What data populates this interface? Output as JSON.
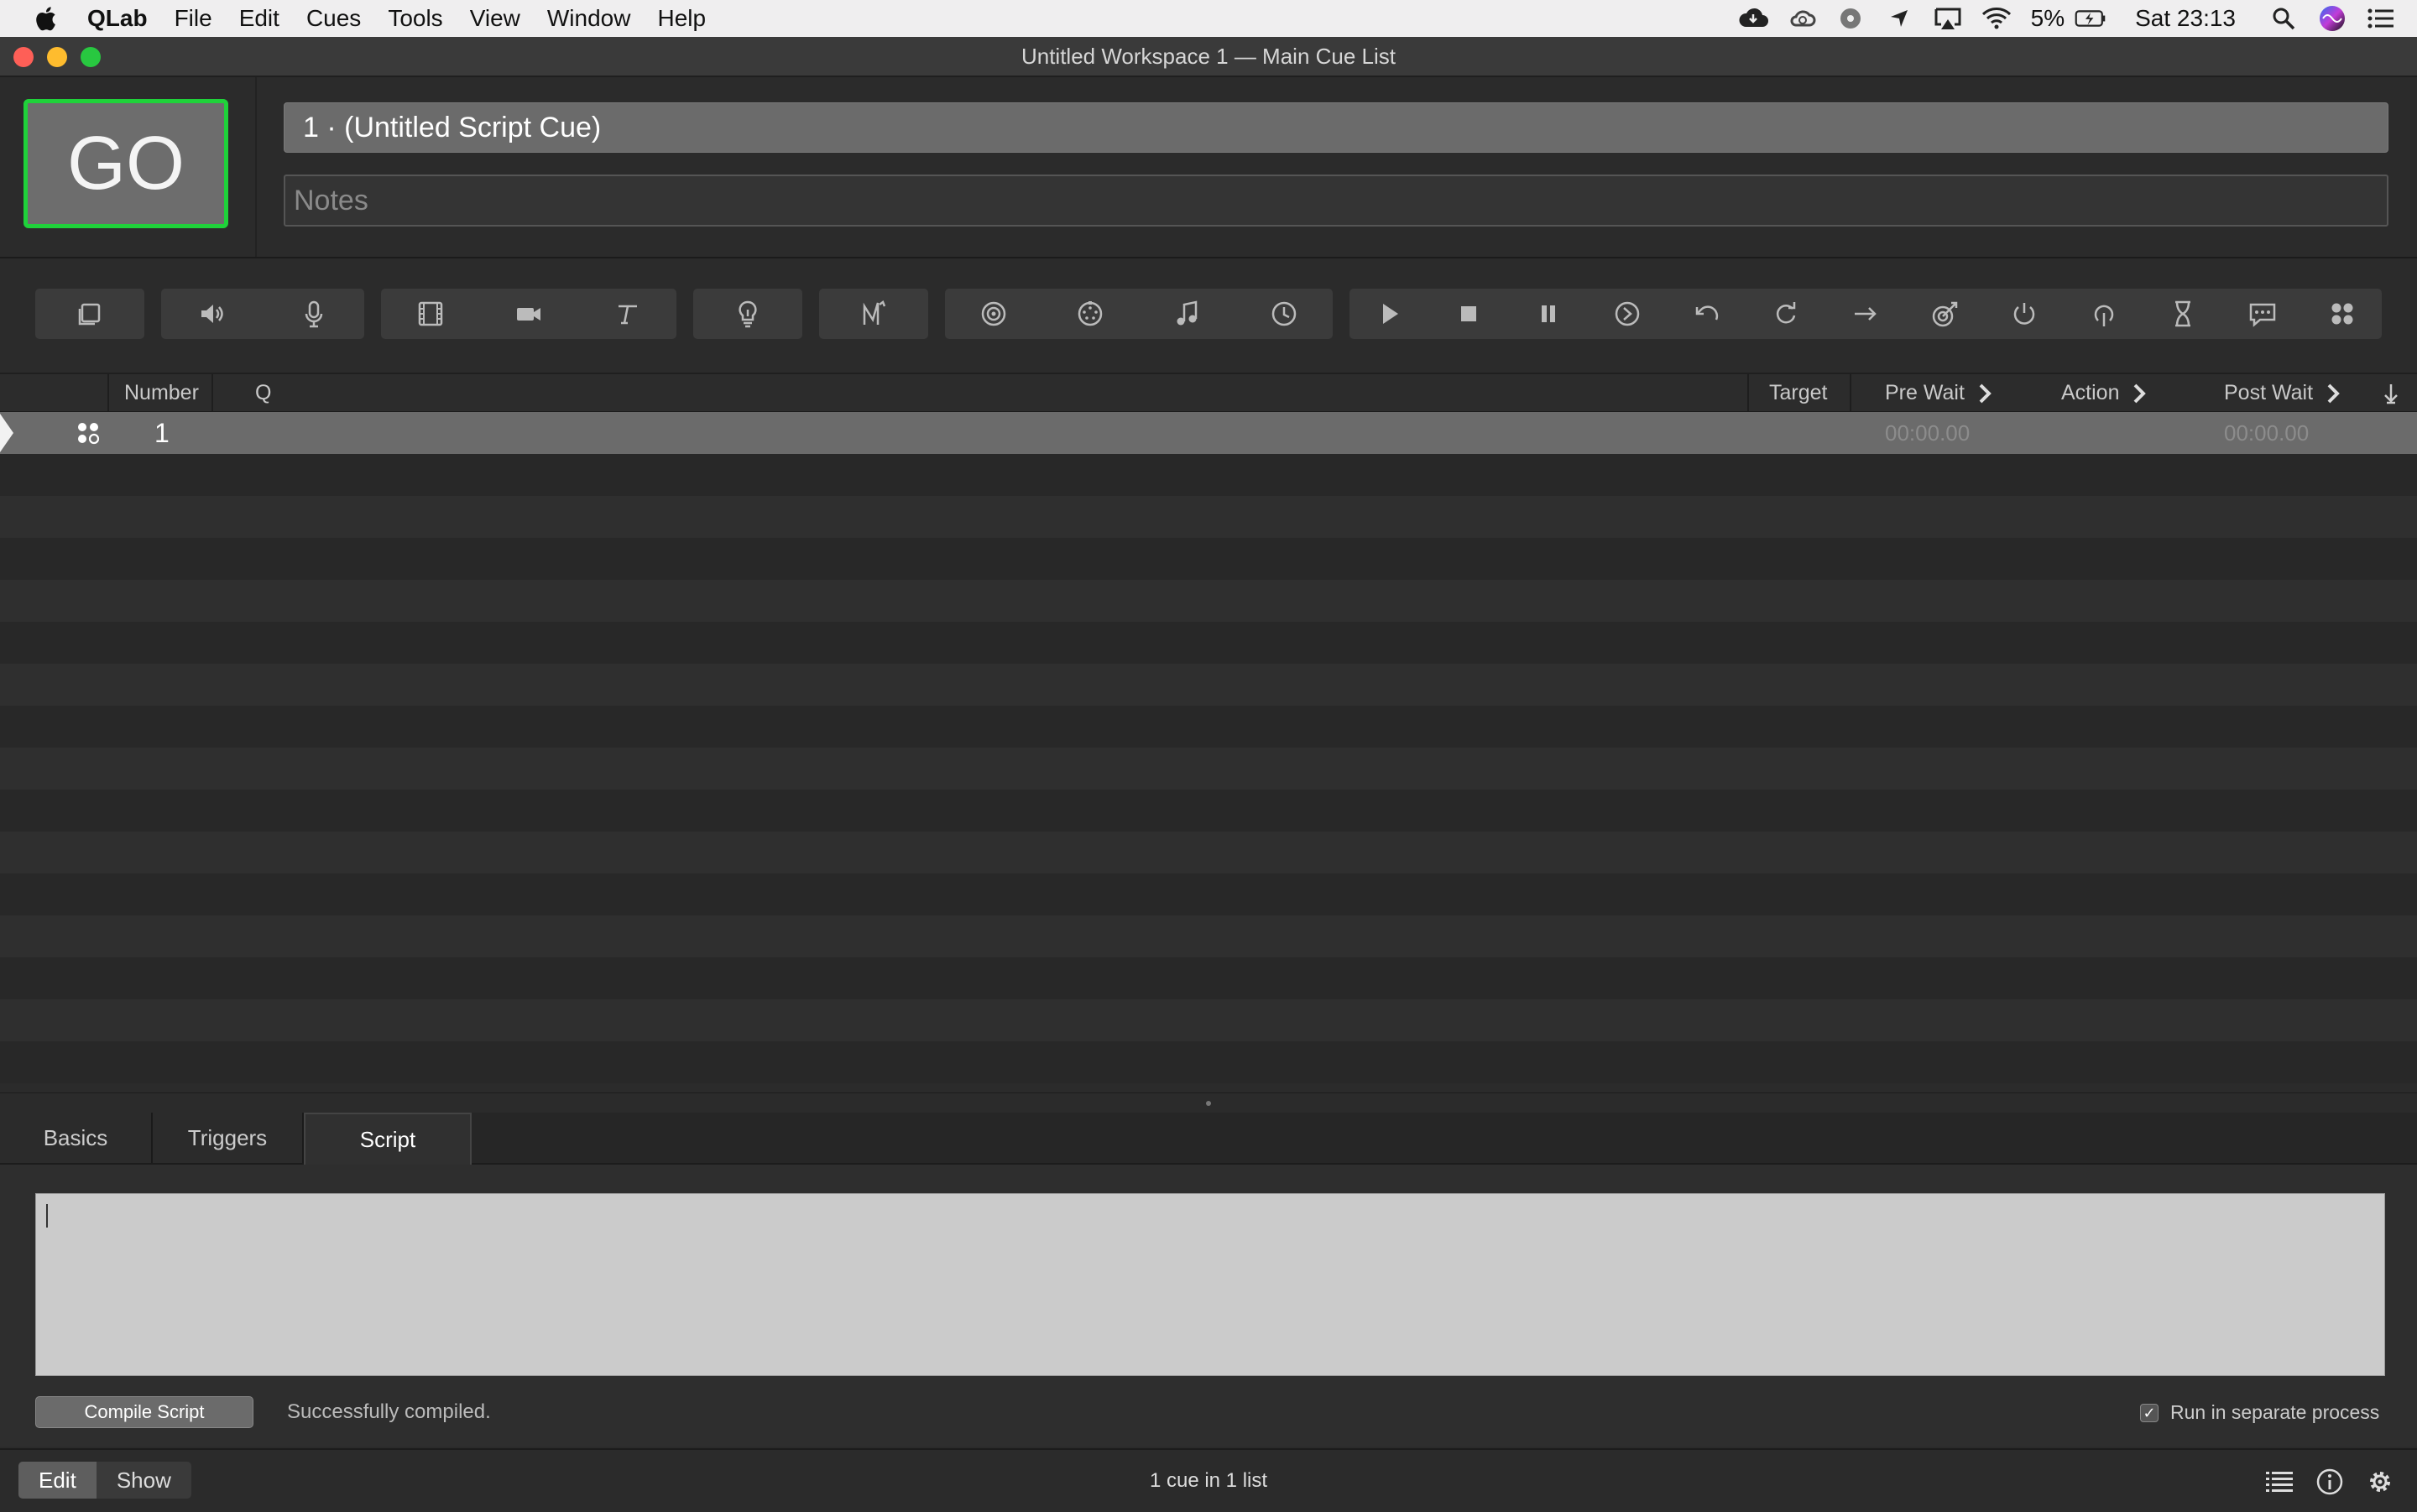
{
  "menubar": {
    "app_name": "QLab",
    "menus": [
      "File",
      "Edit",
      "Cues",
      "Tools",
      "View",
      "Window",
      "Help"
    ],
    "battery": "5%",
    "clock": "Sat 23:13",
    "status_icons": [
      "cloud-icon",
      "creative-cloud-icon",
      "ball-icon",
      "location-icon",
      "airplay-icon",
      "wifi-icon",
      "battery-icon",
      "spotlight-icon",
      "siri-icon",
      "notification-center-icon"
    ]
  },
  "window": {
    "title": "Untitled Workspace 1 — Main Cue List"
  },
  "header": {
    "go_label": "GO",
    "cue_name": "1 · (Untitled Script Cue)",
    "notes_placeholder": "Notes",
    "go_color": "#1fd23a"
  },
  "toolbar": {
    "groups": [
      [
        "group-cue-icon"
      ],
      [
        "audio-cue-icon",
        "mic-cue-icon"
      ],
      [
        "video-cue-icon",
        "camera-cue-icon",
        "text-cue-icon"
      ],
      [
        "light-cue-icon"
      ],
      [
        "fade-cue-icon"
      ],
      [
        "network-cue-icon",
        "midi-cue-icon",
        "midi-file-cue-icon",
        "timecode-cue-icon"
      ],
      [
        "start-cue-icon",
        "stop-cue-icon",
        "pause-cue-icon",
        "load-cue-icon",
        "reset-cue-icon",
        "devamp-cue-icon",
        "goto-cue-icon",
        "target-cue-icon",
        "arm-cue-icon",
        "disarm-cue-icon",
        "wait-cue-icon",
        "memo-cue-icon",
        "script-cue-icon"
      ]
    ]
  },
  "cue_list": {
    "columns": {
      "number": "Number",
      "q": "Q",
      "target": "Target",
      "pre_wait": "Pre Wait",
      "action": "Action",
      "post_wait": "Post Wait"
    },
    "rows": [
      {
        "number": "1",
        "q": "",
        "target": "",
        "pre_wait": "00:00.00",
        "action": "",
        "post_wait": "00:00.00",
        "type_icon": "script-cue-icon"
      }
    ]
  },
  "inspector": {
    "tabs": [
      "Basics",
      "Triggers",
      "Script"
    ],
    "active_tab": "Script",
    "script_source": "",
    "compile_label": "Compile Script",
    "compile_status": "Successfully compiled.",
    "separate_process_label": "Run in separate process",
    "separate_process_checked": true
  },
  "footer": {
    "edit_label": "Edit",
    "show_label": "Show",
    "status": "1 cue in 1 list",
    "icons": [
      "cue-lists-icon",
      "info-icon",
      "settings-icon"
    ]
  }
}
